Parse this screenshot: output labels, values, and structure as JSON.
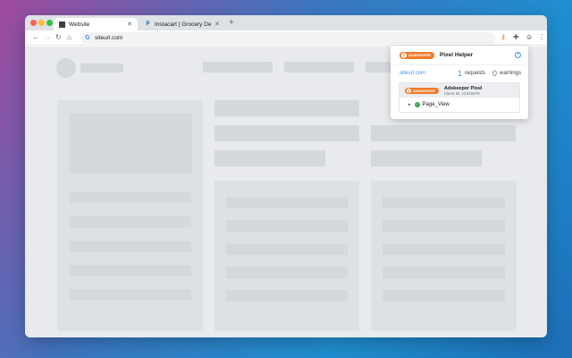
{
  "tabs": [
    {
      "label": "Website",
      "active": true
    },
    {
      "label": "Instacart | Grocery Delivery or Pickup",
      "active": false
    }
  ],
  "address_bar": {
    "url": "siteurl.com"
  },
  "popup": {
    "brand": "ADSKEEPER",
    "title": "Pixel Helper",
    "site": "siteurl.com",
    "requests_count": "1",
    "requests_label": "requests",
    "warnings_count": "0",
    "warnings_label": "warnings",
    "pixel": {
      "name": "Adskeeper Pixel",
      "client_id": "Client ID: 12345678"
    },
    "event": "Page_View"
  },
  "colors": {
    "accent": "#f07b2c",
    "link": "#4a90e2",
    "success": "#2ea44f"
  }
}
